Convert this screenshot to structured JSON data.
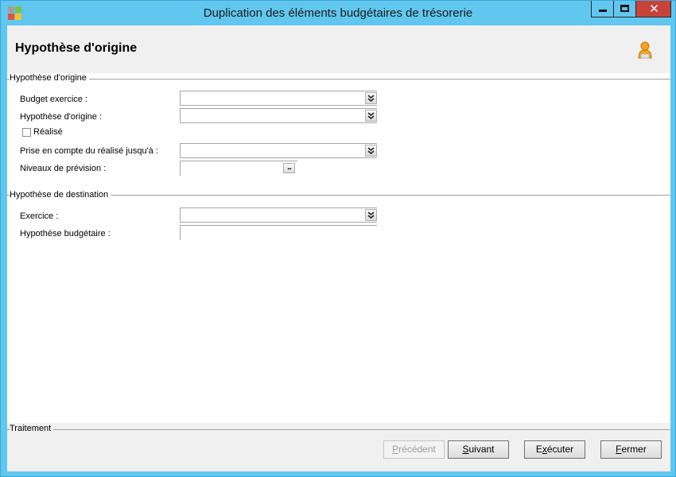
{
  "window": {
    "title": "Duplication des éléments budgétaires de trésorerie",
    "minimize_glyph": "",
    "maximize_glyph": "",
    "close_glyph": "✕"
  },
  "header": {
    "title": "Hypothèse d'origine",
    "icon": "user-icon"
  },
  "origin_group": {
    "title": "Hypothèse d'origine",
    "fields": {
      "budget_exercice": {
        "label": "Budget exercice :",
        "value": ""
      },
      "hypothese_origine": {
        "label": "Hypothèse d'origine :",
        "value": ""
      },
      "realise": {
        "label": "Réalisé",
        "checked": false
      },
      "prise_en_compte": {
        "label": "Prise en compte du réalisé jusqu'à :",
        "value": ""
      },
      "niveaux_prevision": {
        "label": "Niveaux de prévision :",
        "value": "",
        "button_label": "..."
      }
    }
  },
  "destination_group": {
    "title": "Hypothèse de destination",
    "fields": {
      "exercice": {
        "label": "Exercice :",
        "value": ""
      },
      "hypothese_budgetaire": {
        "label": "Hypothèse budgétaire :",
        "value": ""
      }
    }
  },
  "footer": {
    "title": "Traitement",
    "buttons": {
      "precedent": {
        "accel": "P",
        "rest": "récédent",
        "enabled": false
      },
      "suivant": {
        "accel": "S",
        "rest": "uivant",
        "enabled": true
      },
      "executer": {
        "pre": "E",
        "accel": "x",
        "rest": "écuter",
        "enabled": true
      },
      "fermer": {
        "accel": "F",
        "rest": "ermer",
        "enabled": true
      }
    }
  },
  "colors": {
    "titlebar": "#61c7ee",
    "close_button": "#c7433a",
    "panel": "#f0f0f0"
  }
}
